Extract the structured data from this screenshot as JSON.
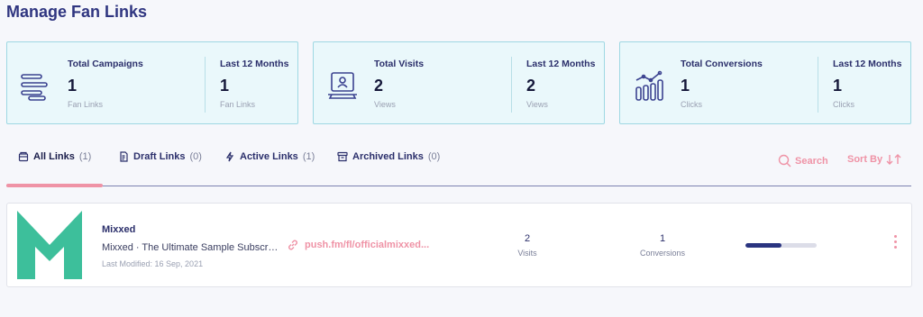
{
  "page": {
    "title": "Manage Fan Links"
  },
  "stats": [
    {
      "icon": "campaigns-list-icon",
      "label": "Total Campaigns",
      "value": "1",
      "unit": "Fan Links",
      "period_label": "Last 12 Months",
      "period_value": "1",
      "period_unit": "Fan Links"
    },
    {
      "icon": "visits-monitor-icon",
      "label": "Total Visits",
      "value": "2",
      "unit": "Views",
      "period_label": "Last 12 Months",
      "period_value": "2",
      "period_unit": "Views"
    },
    {
      "icon": "conversions-chart-icon",
      "label": "Total Conversions",
      "value": "1",
      "unit": "Clicks",
      "period_label": "Last 12 Months",
      "period_value": "1",
      "period_unit": "Clicks"
    }
  ],
  "tabs": [
    {
      "label": "All Links",
      "count": "(1)",
      "icon": "all-links-icon",
      "active": true
    },
    {
      "label": "Draft Links",
      "count": "(0)",
      "icon": "draft-icon",
      "active": false
    },
    {
      "label": "Active Links",
      "count": "(1)",
      "icon": "lightning-icon",
      "active": false
    },
    {
      "label": "Archived Links",
      "count": "(0)",
      "icon": "archive-icon",
      "active": false
    }
  ],
  "toolbar": {
    "search_label": "Search",
    "sort_label": "Sort By"
  },
  "links": [
    {
      "name": "Mixxed",
      "description": "Mixxed · The Ultimate Sample Subscription",
      "modified": "Last Modified: 16 Sep, 2021",
      "url": "push.fm/fl/officialmixxed...",
      "visits": "2",
      "visits_label": "Visits",
      "conversions": "1",
      "conversions_label": "Conversions",
      "progress": 0.5
    }
  ],
  "colors": {
    "accent": "#ef93a6",
    "primary": "#2f3580",
    "card_bg": "#eaf8fb",
    "card_border": "#9fd8e3",
    "logo": "#3dbf9b"
  }
}
